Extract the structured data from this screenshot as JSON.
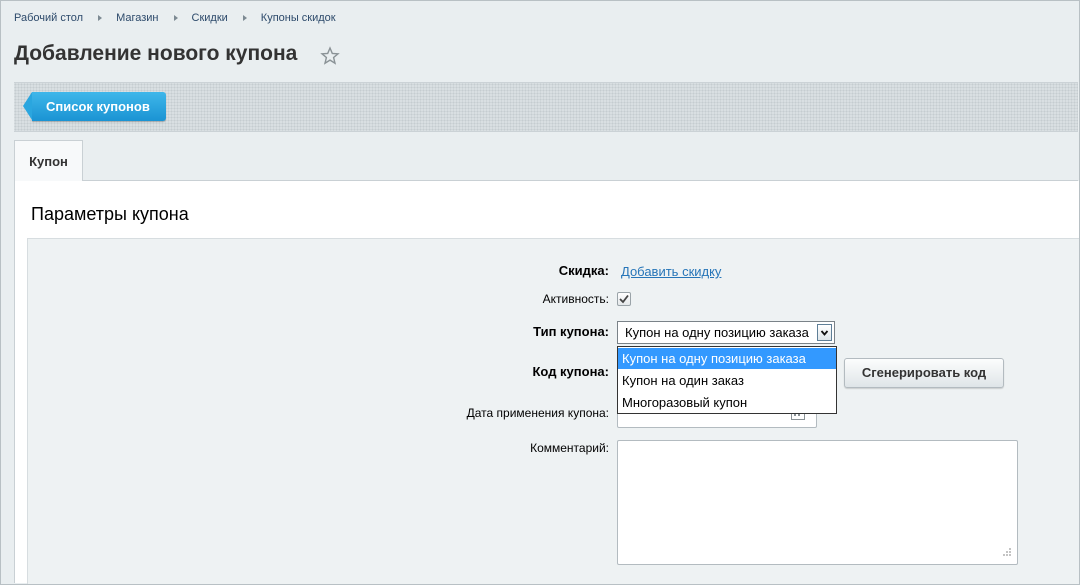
{
  "breadcrumb": [
    "Рабочий стол",
    "Магазин",
    "Скидки",
    "Купоны скидок"
  ],
  "page": {
    "title": "Добавление нового купона",
    "favorite_icon": "star-icon"
  },
  "toolbar": {
    "list_button": "Список купонов"
  },
  "tabs": [
    {
      "label": "Купон"
    }
  ],
  "section": {
    "title": "Параметры купона"
  },
  "form": {
    "discount": {
      "label": "Скидка:",
      "link": "Добавить скидку"
    },
    "active": {
      "label": "Активность:",
      "checked": true
    },
    "coupon_type": {
      "label": "Тип купона:",
      "value": "Купон на одну позицию заказа",
      "options": [
        "Купон на одну позицию заказа",
        "Купон на один заказ",
        "Многоразовый купон"
      ],
      "highlighted": 0
    },
    "coupon_code": {
      "label": "Код купона:",
      "generate_button": "Сгенерировать код"
    },
    "apply_date": {
      "label": "Дата применения купона:",
      "icon": "calendar-icon"
    },
    "comment": {
      "label": "Комментарий:"
    }
  },
  "colors": {
    "accent": "#1a93d3",
    "link": "#2675b8",
    "highlight": "#3399ff"
  }
}
